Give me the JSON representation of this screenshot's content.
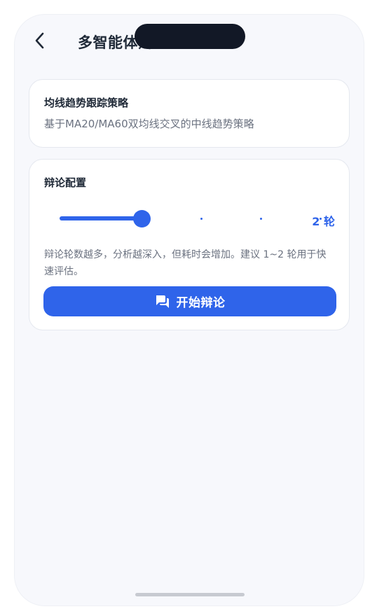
{
  "header": {
    "title": "多智能体辩论"
  },
  "strategy": {
    "name": "均线趋势跟踪策略",
    "description": "基于MA20/MA60双均线交叉的中线趋势策略"
  },
  "config": {
    "title": "辩论配置",
    "rounds": {
      "value": 2,
      "min": 1,
      "max": 5,
      "label": "2 轮"
    },
    "hint": "辩论轮数越多，分析越深入，但耗时会增加。建议 1~2 轮用于快速评估。",
    "start_label": "开始辩论"
  },
  "colors": {
    "accent": "#2f64ea",
    "background": "#f7f8fc",
    "text_primary": "#1f2937",
    "text_secondary": "#6b7280"
  },
  "icons": {
    "back": "chevron-left-icon",
    "start": "chat-bubble-icon"
  }
}
